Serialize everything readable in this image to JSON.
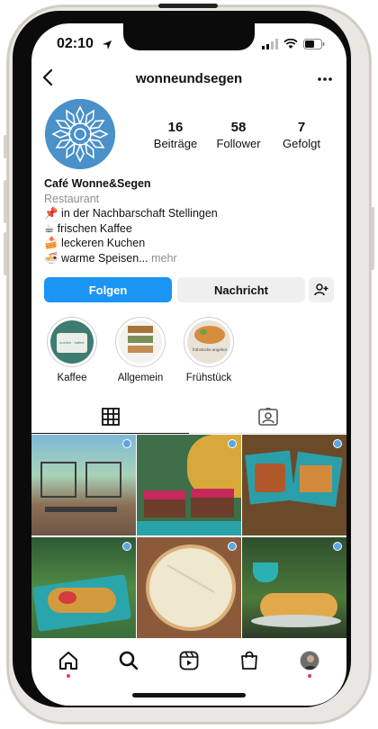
{
  "status_bar": {
    "time": "02:10"
  },
  "header": {
    "username": "wonneundsegen"
  },
  "profile": {
    "stats": [
      {
        "value": "16",
        "label": "Beiträge"
      },
      {
        "value": "58",
        "label": "Follower"
      },
      {
        "value": "7",
        "label": "Gefolgt"
      }
    ],
    "name": "Café Wonne&Segen",
    "category": "Restaurant",
    "bio_lines": [
      "📌 in der Nachbarschaft Stellingen",
      "☕ frischen Kaffee",
      "🍰 leckeren Kuchen",
      "🍜 warme Speisen..."
    ],
    "more_label": "mehr"
  },
  "actions": {
    "follow_label": "Folgen",
    "message_label": "Nachricht"
  },
  "highlights": [
    {
      "label": "Kaffee",
      "cover_text": "kuchen · kaffee"
    },
    {
      "label": "Allgemein"
    },
    {
      "label": "Frühstück",
      "cover_text": "frühstücks-angebot"
    }
  ],
  "tabs": [
    {
      "name": "grid"
    },
    {
      "name": "tagged"
    }
  ],
  "colors": {
    "accent": "#1b95f3",
    "notification_dot": "#ed3a4f",
    "logo_blue": "#4a90c9"
  },
  "nav": [
    "home-icon",
    "search-icon",
    "reels-icon",
    "shop-icon",
    "profile-avatar"
  ]
}
